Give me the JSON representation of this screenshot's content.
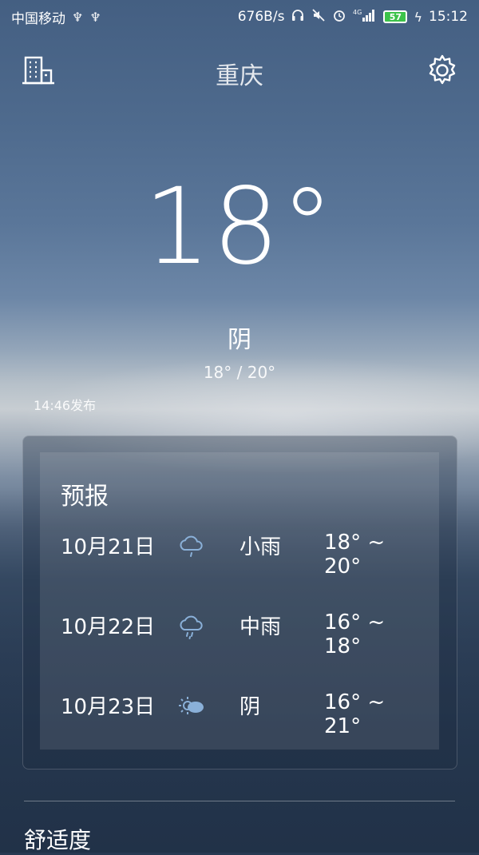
{
  "status_bar": {
    "carrier": "中国移动",
    "net_speed": "676B/s",
    "net_type": "4G",
    "battery": "57",
    "time": "15:12",
    "icons": [
      "usb-icon",
      "usb-icon",
      "headset-icon",
      "mute-icon",
      "alarm-icon",
      "signal-icon",
      "charging-icon"
    ]
  },
  "header": {
    "city": "重庆",
    "left_icon": "city-list-icon",
    "right_icon": "gear-icon"
  },
  "current": {
    "temperature": "18°",
    "condition": "阴",
    "range": "18° / 20°",
    "published": "14:46发布"
  },
  "forecast": {
    "title": "预报",
    "days": [
      {
        "date": "10月21日",
        "icon": "light-rain-icon",
        "condition": "小雨",
        "temps": "18° ~ 20°"
      },
      {
        "date": "10月22日",
        "icon": "moderate-rain-icon",
        "condition": "中雨",
        "temps": "16° ~ 18°"
      },
      {
        "date": "10月23日",
        "icon": "overcast-sun-icon",
        "condition": "阴",
        "temps": "16° ~ 21°"
      }
    ]
  },
  "comfort": {
    "title": "舒适度"
  },
  "colors": {
    "battery_fill": "#3cc24a",
    "icon_blue": "#8ab0d8"
  }
}
